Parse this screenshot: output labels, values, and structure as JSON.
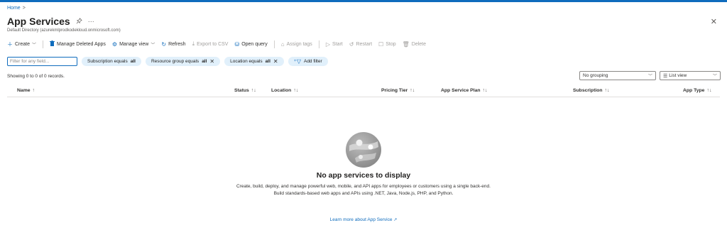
{
  "breadcrumb": {
    "home": "Home",
    "separator": ">"
  },
  "header": {
    "title": "App Services",
    "subtitle": "Default Directory (azurekmlprodkodekloud.onmicrosoft.com)",
    "pin_icon": "pin-icon",
    "more_icon": "ellipsis-icon",
    "close_icon": "close-icon"
  },
  "toolbar": {
    "create": "Create",
    "manage_deleted": "Manage Deleted Apps",
    "manage_view": "Manage view",
    "refresh": "Refresh",
    "export_csv": "Export to CSV",
    "open_query": "Open query",
    "assign_tags": "Assign tags",
    "start": "Start",
    "restart": "Restart",
    "stop": "Stop",
    "delete": "Delete"
  },
  "filters": {
    "placeholder": "Filter for any field...",
    "pills": [
      {
        "label": "Subscription equals",
        "value": "all"
      },
      {
        "label": "Resource group equals",
        "value": "all"
      },
      {
        "label": "Location equals",
        "value": "all"
      }
    ],
    "add_filter": "Add filter"
  },
  "records_text": "Showing 0 to 0 of 0 records.",
  "grouping": {
    "selected": "No grouping"
  },
  "view": {
    "selected": "List view"
  },
  "columns": [
    "Name",
    "Status",
    "Location",
    "Pricing Tier",
    "App Service Plan",
    "Subscription",
    "App Type"
  ],
  "empty_state": {
    "title": "No app services to display",
    "description": "Create, build, deploy, and manage powerful web, mobile, and API apps for employees or customers using a single back-end. Build standards-based web apps and APIs using .NET, Java, Node.js, PHP, and Python.",
    "learn_more": "Learn more about App Service"
  },
  "colors": {
    "accent": "#0f6cbd",
    "pill_bg": "#e1f0fb",
    "text": "#323130"
  }
}
